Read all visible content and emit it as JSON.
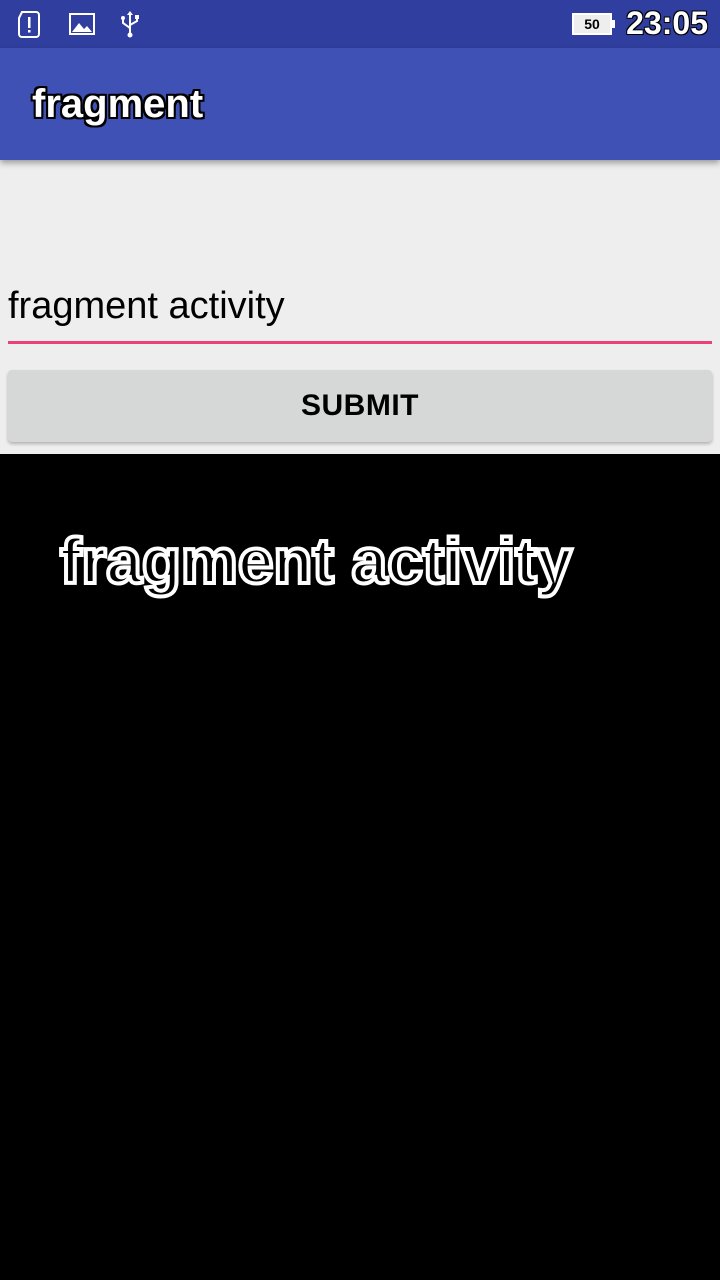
{
  "status_bar": {
    "icons": [
      "sim-alert-icon",
      "image-icon",
      "usb-icon"
    ],
    "battery_level": "50",
    "time": "23:05"
  },
  "app_bar": {
    "title": "fragment"
  },
  "form": {
    "input_value": "fragment activity",
    "submit_label": "SUBMIT"
  },
  "fragment": {
    "text": "fragment activity"
  },
  "colors": {
    "status_bar": "#303f9f",
    "app_bar": "#3f51b5",
    "accent": "#ec407a",
    "content_bg": "#eeeeee",
    "button_bg": "#d6d7d7",
    "fragment_bg": "#000000"
  }
}
